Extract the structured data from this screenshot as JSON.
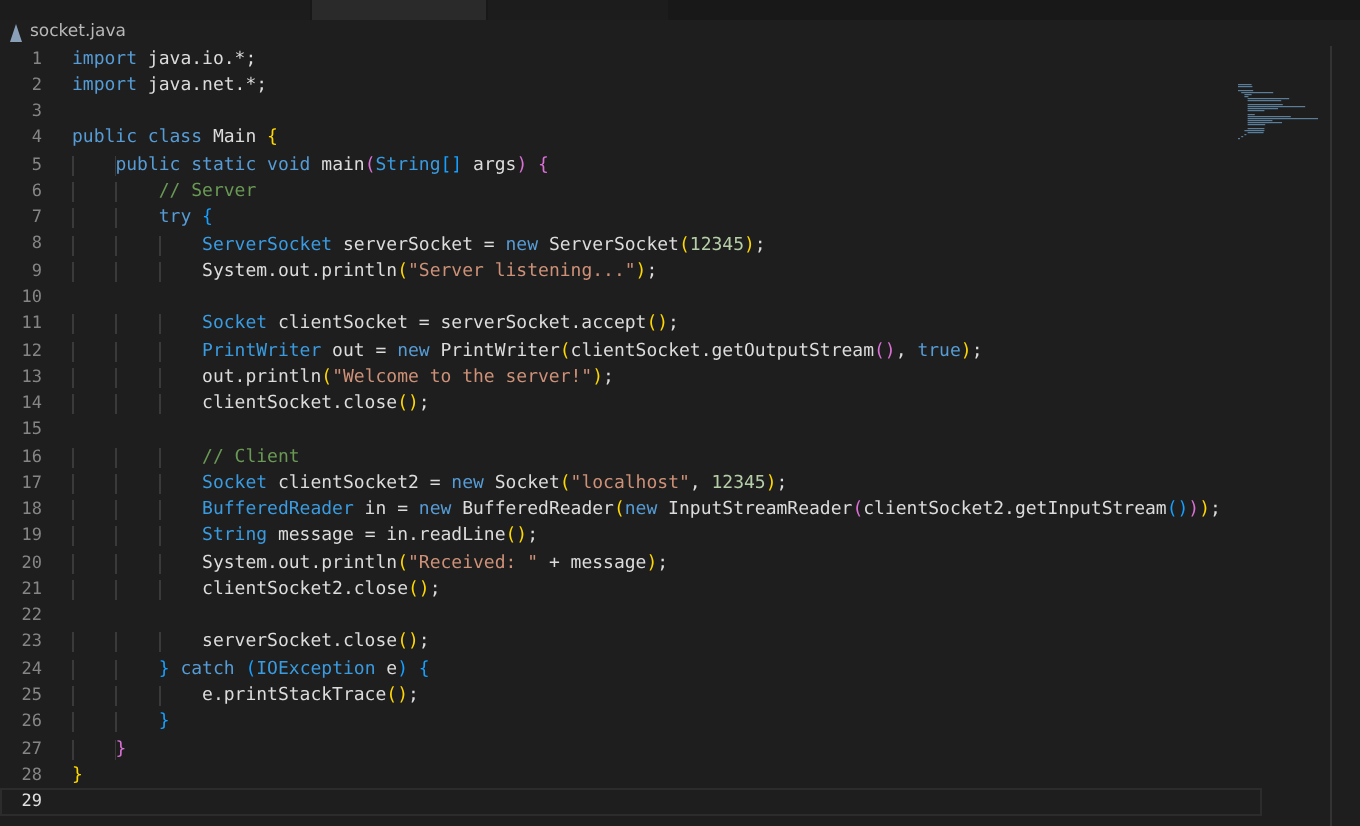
{
  "tabs": [
    {
      "selected": false
    },
    {
      "selected": true
    },
    {
      "selected": false
    }
  ],
  "breadcrumb": {
    "file": "socket.java"
  },
  "lines": [
    {
      "number": "1",
      "current": false,
      "tokens": [
        {
          "kind": "kw",
          "text": "import"
        },
        {
          "kind": "plain",
          "text": " java.io.*;"
        }
      ]
    },
    {
      "number": "2",
      "current": false,
      "tokens": [
        {
          "kind": "kw",
          "text": "import"
        },
        {
          "kind": "plain",
          "text": " java.net.*;"
        }
      ]
    },
    {
      "number": "3",
      "current": false
    },
    {
      "number": "4",
      "current": false,
      "tokens": [
        {
          "kind": "kw",
          "text": "public class"
        },
        {
          "kind": "plain",
          "text": " Main "
        },
        {
          "kind": "b1",
          "text": "{"
        }
      ]
    },
    {
      "number": "5",
      "current": false,
      "tokens": [
        {
          "kind": "kw",
          "text": "    public static void"
        },
        {
          "kind": "plain",
          "text": " main"
        },
        {
          "kind": "b2",
          "text": "("
        },
        {
          "kind": "type",
          "text": "String"
        },
        {
          "kind": "b3",
          "text": "[]"
        },
        {
          "kind": "plain",
          "text": " args"
        },
        {
          "kind": "b2",
          "text": ")"
        },
        {
          "kind": "b2",
          "text": " {"
        }
      ]
    },
    {
      "number": "6",
      "current": false,
      "tokens": [
        {
          "kind": "com",
          "text": "        // Server"
        }
      ]
    },
    {
      "number": "7",
      "current": false,
      "tokens": [
        {
          "kind": "kw",
          "text": "        try"
        },
        {
          "kind": "b3",
          "text": " {"
        }
      ]
    },
    {
      "number": "8",
      "current": false,
      "tokens": [
        {
          "kind": "type",
          "text": "            ServerSocket"
        },
        {
          "kind": "plain",
          "text": " serverSocket = "
        },
        {
          "kind": "kw",
          "text": "new"
        },
        {
          "kind": "plain",
          "text": " ServerSocket"
        },
        {
          "kind": "b1",
          "text": "("
        },
        {
          "kind": "num",
          "text": "12345"
        },
        {
          "kind": "b1",
          "text": ")"
        },
        {
          "kind": "plain",
          "text": ";"
        }
      ]
    },
    {
      "number": "9",
      "current": false,
      "tokens": [
        {
          "kind": "plain",
          "text": "            System.out.println"
        },
        {
          "kind": "b1",
          "text": "("
        },
        {
          "kind": "str",
          "text": "\"Server listening...\""
        },
        {
          "kind": "b1",
          "text": ")"
        },
        {
          "kind": "plain",
          "text": ";"
        }
      ]
    },
    {
      "number": "10",
      "current": false
    },
    {
      "number": "11",
      "current": false,
      "tokens": [
        {
          "kind": "type",
          "text": "            Socket"
        },
        {
          "kind": "plain",
          "text": " clientSocket = serverSocket.accept"
        },
        {
          "kind": "b1",
          "text": "()"
        },
        {
          "kind": "plain",
          "text": ";"
        }
      ]
    },
    {
      "number": "12",
      "current": false,
      "tokens": [
        {
          "kind": "type",
          "text": "            PrintWriter"
        },
        {
          "kind": "plain",
          "text": " out = "
        },
        {
          "kind": "kw",
          "text": "new"
        },
        {
          "kind": "plain",
          "text": " PrintWriter"
        },
        {
          "kind": "b1",
          "text": "("
        },
        {
          "kind": "plain",
          "text": "clientSocket.getOutputStream"
        },
        {
          "kind": "b2",
          "text": "()"
        },
        {
          "kind": "plain",
          "text": ", "
        },
        {
          "kind": "kw",
          "text": "true"
        },
        {
          "kind": "b1",
          "text": ")"
        },
        {
          "kind": "plain",
          "text": ";"
        }
      ]
    },
    {
      "number": "13",
      "current": false,
      "tokens": [
        {
          "kind": "plain",
          "text": "            out.println"
        },
        {
          "kind": "b1",
          "text": "("
        },
        {
          "kind": "str",
          "text": "\"Welcome to the server!\""
        },
        {
          "kind": "b1",
          "text": ")"
        },
        {
          "kind": "plain",
          "text": ";"
        }
      ]
    },
    {
      "number": "14",
      "current": false,
      "tokens": [
        {
          "kind": "plain",
          "text": "            clientSocket.close"
        },
        {
          "kind": "b1",
          "text": "()"
        },
        {
          "kind": "plain",
          "text": ";"
        }
      ]
    },
    {
      "number": "15",
      "current": false
    },
    {
      "number": "16",
      "current": false,
      "tokens": [
        {
          "kind": "com",
          "text": "            // Client"
        }
      ]
    },
    {
      "number": "17",
      "current": false,
      "tokens": [
        {
          "kind": "type",
          "text": "            Socket"
        },
        {
          "kind": "plain",
          "text": " clientSocket2 = "
        },
        {
          "kind": "kw",
          "text": "new"
        },
        {
          "kind": "plain",
          "text": " Socket"
        },
        {
          "kind": "b1",
          "text": "("
        },
        {
          "kind": "str",
          "text": "\"localhost\""
        },
        {
          "kind": "plain",
          "text": ", "
        },
        {
          "kind": "num",
          "text": "12345"
        },
        {
          "kind": "b1",
          "text": ")"
        },
        {
          "kind": "plain",
          "text": ";"
        }
      ]
    },
    {
      "number": "18",
      "current": false,
      "tokens": [
        {
          "kind": "type",
          "text": "            BufferedReader"
        },
        {
          "kind": "plain",
          "text": " in = "
        },
        {
          "kind": "kw",
          "text": "new"
        },
        {
          "kind": "plain",
          "text": " BufferedReader"
        },
        {
          "kind": "b1",
          "text": "("
        },
        {
          "kind": "kw",
          "text": "new"
        },
        {
          "kind": "plain",
          "text": " InputStreamReader"
        },
        {
          "kind": "b2",
          "text": "("
        },
        {
          "kind": "plain",
          "text": "clientSocket2.getInputStream"
        },
        {
          "kind": "b3",
          "text": "()"
        },
        {
          "kind": "b2",
          "text": ")"
        },
        {
          "kind": "b1",
          "text": ")"
        },
        {
          "kind": "plain",
          "text": ";"
        }
      ]
    },
    {
      "number": "19",
      "current": false,
      "tokens": [
        {
          "kind": "type",
          "text": "            String"
        },
        {
          "kind": "plain",
          "text": " message = in.readLine"
        },
        {
          "kind": "b1",
          "text": "()"
        },
        {
          "kind": "plain",
          "text": ";"
        }
      ]
    },
    {
      "number": "20",
      "current": false,
      "tokens": [
        {
          "kind": "plain",
          "text": "            System.out.println"
        },
        {
          "kind": "b1",
          "text": "("
        },
        {
          "kind": "str",
          "text": "\"Received: \""
        },
        {
          "kind": "plain",
          "text": " + message"
        },
        {
          "kind": "b1",
          "text": ")"
        },
        {
          "kind": "plain",
          "text": ";"
        }
      ]
    },
    {
      "number": "21",
      "current": false,
      "tokens": [
        {
          "kind": "plain",
          "text": "            clientSocket2.close"
        },
        {
          "kind": "b1",
          "text": "()"
        },
        {
          "kind": "plain",
          "text": ";"
        }
      ]
    },
    {
      "number": "22",
      "current": false
    },
    {
      "number": "23",
      "current": false,
      "tokens": [
        {
          "kind": "plain",
          "text": "            serverSocket.close"
        },
        {
          "kind": "b1",
          "text": "()"
        },
        {
          "kind": "plain",
          "text": ";"
        }
      ]
    },
    {
      "number": "24",
      "current": false,
      "tokens": [
        {
          "kind": "b3",
          "text": "        }"
        },
        {
          "kind": "kw",
          "text": " catch"
        },
        {
          "kind": "b3",
          "text": " ("
        },
        {
          "kind": "type",
          "text": "IOException"
        },
        {
          "kind": "plain",
          "text": " e"
        },
        {
          "kind": "b3",
          "text": ")"
        },
        {
          "kind": "b3",
          "text": " {"
        }
      ]
    },
    {
      "number": "25",
      "current": false,
      "tokens": [
        {
          "kind": "plain",
          "text": "            e.printStackTrace"
        },
        {
          "kind": "b1",
          "text": "()"
        },
        {
          "kind": "plain",
          "text": ";"
        }
      ]
    },
    {
      "number": "26",
      "current": false,
      "tokens": [
        {
          "kind": "b3",
          "text": "        }"
        }
      ]
    },
    {
      "number": "27",
      "current": false,
      "tokens": [
        {
          "kind": "b2",
          "text": "    }"
        }
      ]
    },
    {
      "number": "28",
      "current": false,
      "tokens": [
        {
          "kind": "b1",
          "text": "}"
        }
      ]
    },
    {
      "number": "29",
      "current": true
    }
  ]
}
